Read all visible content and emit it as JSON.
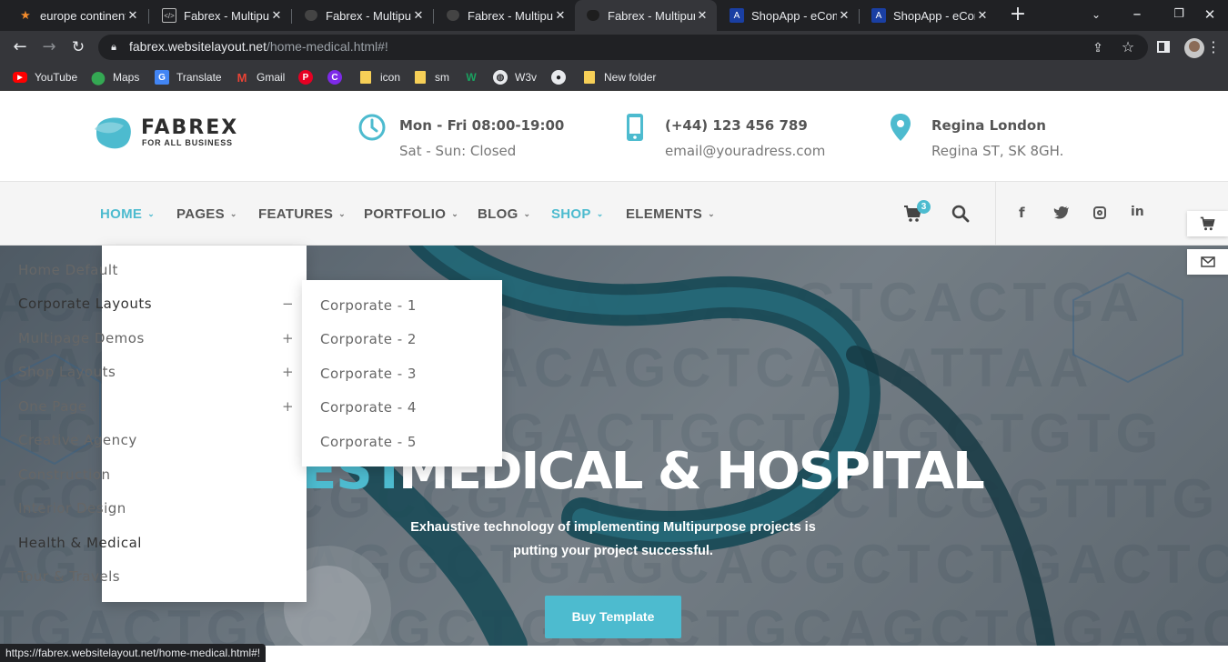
{
  "browser": {
    "tabs": [
      {
        "title": "europe continent",
        "favicon": "star-favicon",
        "active": false
      },
      {
        "title": "Fabrex - Multipur",
        "favicon": "code-favicon",
        "active": false
      },
      {
        "title": "Fabrex - Multipur",
        "favicon": "fabrex-favicon",
        "active": false
      },
      {
        "title": "Fabrex - Multipur",
        "favicon": "fabrex-favicon",
        "active": false
      },
      {
        "title": "Fabrex - Multipur",
        "favicon": "fabrex-favicon",
        "active": true
      },
      {
        "title": "ShopApp - eCom",
        "favicon": "shopapp-favicon",
        "active": false
      },
      {
        "title": "ShopApp - eCom",
        "favicon": "shopapp-favicon",
        "active": false
      }
    ],
    "url_domain": "fabrex.websitelayout.net",
    "url_path": "/home-medical.html#!",
    "bookmarks": [
      {
        "label": "YouTube",
        "icon": "youtube-icon"
      },
      {
        "label": "Maps",
        "icon": "maps-icon"
      },
      {
        "label": "Translate",
        "icon": "translate-icon"
      },
      {
        "label": "Gmail",
        "icon": "gmail-icon"
      },
      {
        "label": "",
        "icon": "pinterest-icon"
      },
      {
        "label": "",
        "icon": "canva-icon"
      },
      {
        "label": "icon",
        "icon": "folder-icon"
      },
      {
        "label": "sm",
        "icon": "folder-icon"
      },
      {
        "label": "",
        "icon": "w-icon"
      },
      {
        "label": "W3v",
        "icon": "globe-icon"
      },
      {
        "label": "",
        "icon": "github-icon"
      },
      {
        "label": "New folder",
        "icon": "folder-icon"
      }
    ],
    "status_url": "https://fabrex.websitelayout.net/home-medical.html#!"
  },
  "site": {
    "logo_name": "FABREX",
    "logo_tagline": "FOR ALL BUSINESS",
    "hours_line1": "Mon - Fri 08:00-19:00",
    "hours_line2": "Sat - Sun: Closed",
    "phone": "(+44) 123 456 789",
    "email": "email@youradress.com",
    "location_line1": "Regina London",
    "location_line2": "Regina ST, SK 8GH.",
    "nav": [
      "HOME",
      "PAGES",
      "FEATURES",
      "PORTFOLIO",
      "BLOG",
      "SHOP",
      "ELEMENTS"
    ],
    "cart_count": "3",
    "home_menu": [
      {
        "label": "Home Default",
        "sign": ""
      },
      {
        "label": "Corporate Layouts",
        "sign": "−"
      },
      {
        "label": "Multipage Demos",
        "sign": "+"
      },
      {
        "label": "Shop Layouts",
        "sign": "+"
      },
      {
        "label": "One Page",
        "sign": "+"
      },
      {
        "label": "Creative Agency",
        "sign": ""
      },
      {
        "label": "Construction",
        "sign": ""
      },
      {
        "label": "Interior Design",
        "sign": ""
      },
      {
        "label": "Health & Medical",
        "sign": ""
      },
      {
        "label": "Tour & Travels",
        "sign": ""
      }
    ],
    "corporate_submenu": [
      "Corporate - 1",
      "Corporate - 2",
      "Corporate - 3",
      "Corporate - 4",
      "Corporate - 5"
    ],
    "hero_title_accent": "EST",
    "hero_title_main": "MEDICAL & HOSPITAL",
    "hero_sub1": "Exhaustive technology of implementing Multipurpose projects is",
    "hero_sub2": "putting your project successful.",
    "hero_button": "Buy Template",
    "dna_text": [
      "ACATCACAGCTGCAAGAGCTCACTGA",
      "TCAGCTAGGCTCACAGCTCACATTAA",
      "TCAGCGTCAGTGACTGCTGTGCTGTG",
      "TGCGCTGCGCCGAGGTCAGCTCGGTTTG",
      "CAGTCCGCAGGCTGAGCACGCTCTGACTC",
      "TGACTGCCAGCTGCGCTGCAGCTGGAGCA"
    ]
  },
  "colors": {
    "accent": "#4dbbcf",
    "nav_text": "#555555",
    "tab_bg": "#202124",
    "toolbar_bg": "#35363a"
  }
}
